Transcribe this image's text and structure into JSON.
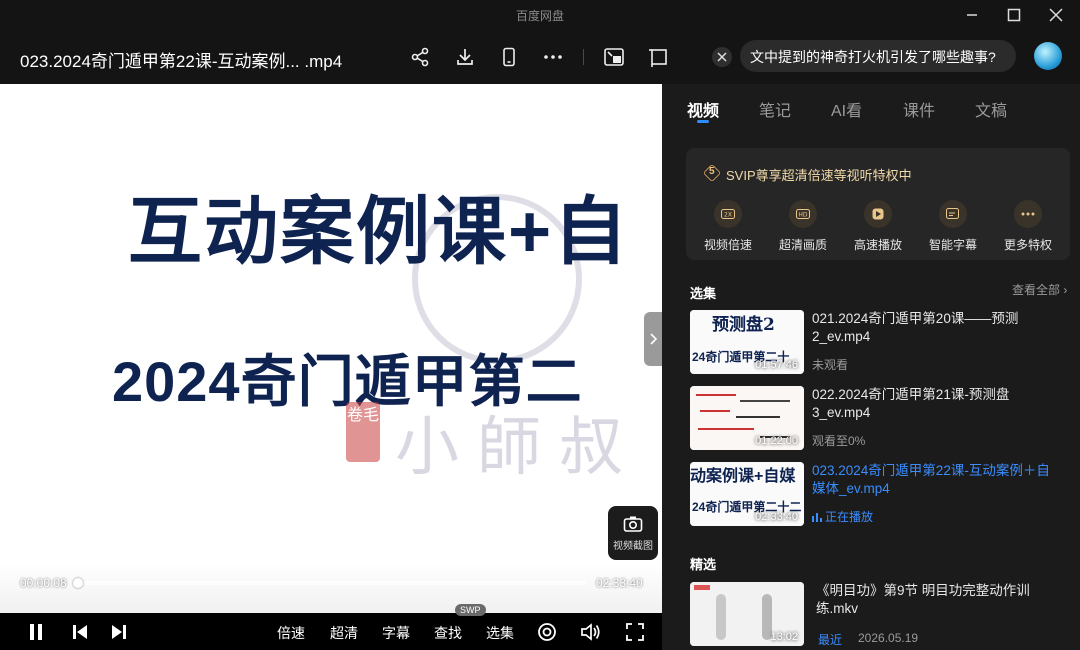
{
  "app": {
    "title": "百度网盘"
  },
  "player": {
    "file_title": "023.2024奇门遁甲第22课-互动案例... .mp4",
    "video": {
      "headline": "互动案例课+自",
      "subline": "2024奇门遁甲第二",
      "watermark_text": "小師叔",
      "seal_text": "卷毛"
    },
    "screenshot_label": "视频截图",
    "time_current": "00:00:08",
    "time_total": "02:33:40",
    "progress": 0.001,
    "controls": {
      "speed": "倍速",
      "quality": "超清",
      "subtitle": "字幕",
      "search": "查找",
      "select": "选集",
      "select_badge": "SWP"
    }
  },
  "panel": {
    "search_text": "文中提到的神奇打火机引发了哪些趣事?",
    "tabs": [
      "视频",
      "笔记",
      "AI看",
      "课件",
      "文稿"
    ],
    "active_tab": 0,
    "svip": {
      "badge": "5",
      "title": "SVIP尊享超清倍速等视听特权中",
      "perks": [
        "视频倍速",
        "超清画质",
        "高速播放",
        "智能字幕",
        "更多特权"
      ]
    },
    "episodes": {
      "title": "选集",
      "view_all": "查看全部",
      "items": [
        {
          "title": "021.2024奇门遁甲第20课——预测2_ev.mp4",
          "duration": "01:57:46",
          "status": "未观看",
          "thumb_top": "预测盘2",
          "thumb_bottom": "24奇门遁甲第二十"
        },
        {
          "title": "022.2024奇门遁甲第21课-预测盘3_ev.mp4",
          "duration": "01:22:00",
          "status": "观看至0%",
          "thumb_top": "",
          "thumb_bottom": ""
        },
        {
          "title": "023.2024奇门遁甲第22课-互动案例＋自媒体_ev.mp4",
          "duration": "02:33:40",
          "status": "正在播放",
          "thumb_top": "动案例课+自媒",
          "thumb_bottom": "24奇门遁甲第二十二"
        }
      ]
    },
    "featured": {
      "title": "精选",
      "items": [
        {
          "title": "《明目功》第9节 明目功完整动作训练.mkv",
          "duration": "13:02",
          "tag": "最近",
          "date": "2026.05.19"
        }
      ]
    }
  },
  "colors": {
    "accent": "#3a8dff",
    "gold": "#f0d9a8",
    "headline": "#0f2351"
  }
}
